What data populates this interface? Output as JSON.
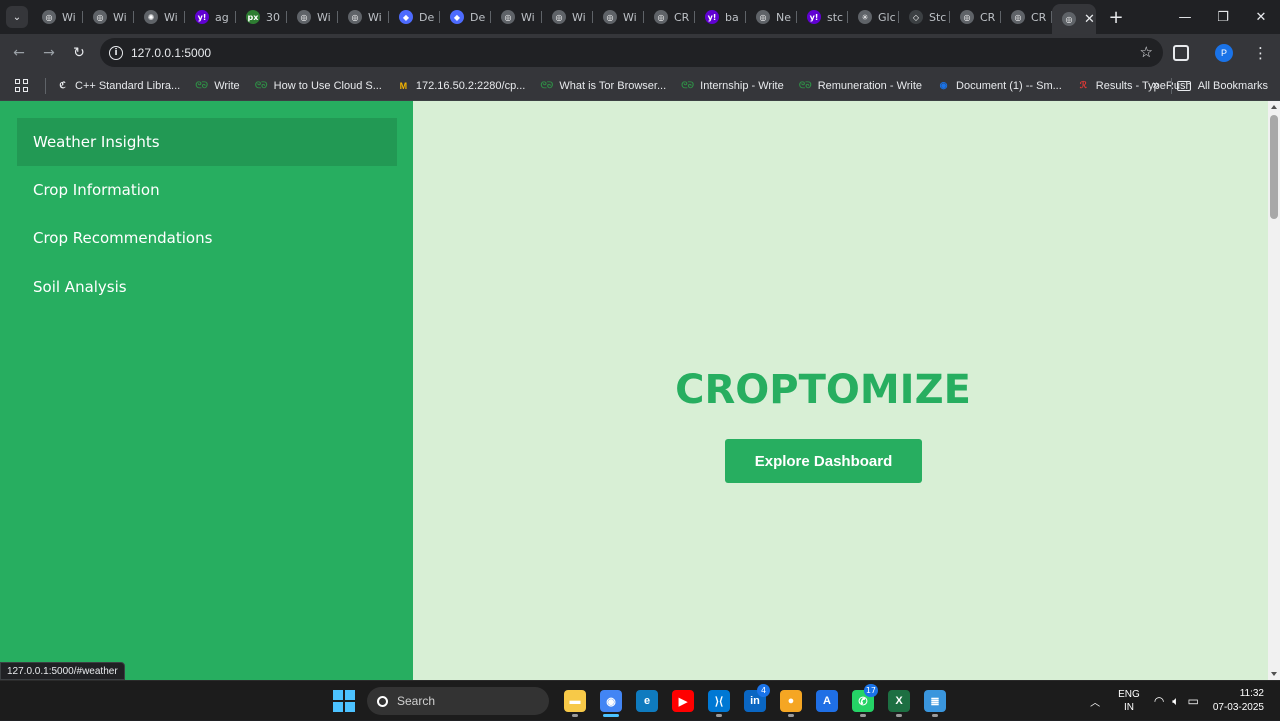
{
  "browser": {
    "tabs": [
      {
        "label": "Wi",
        "icon": "globe-icon"
      },
      {
        "label": "Wi",
        "icon": "globe-icon"
      },
      {
        "label": "Wi",
        "icon": "openai-icon"
      },
      {
        "label": "ag",
        "icon": "yahoo-icon"
      },
      {
        "label": "30",
        "icon": "px-icon"
      },
      {
        "label": "Wi",
        "icon": "globe-icon"
      },
      {
        "label": "Wi",
        "icon": "globe-icon"
      },
      {
        "label": "De",
        "icon": "deepseek-icon"
      },
      {
        "label": "De",
        "icon": "deepseek-icon"
      },
      {
        "label": "Wi",
        "icon": "globe-icon"
      },
      {
        "label": "Wi",
        "icon": "globe-icon"
      },
      {
        "label": "Wi",
        "icon": "globe-icon"
      },
      {
        "label": "CR",
        "icon": "globe-icon"
      },
      {
        "label": "ba",
        "icon": "yahoo-icon"
      },
      {
        "label": "Ne",
        "icon": "globe-icon"
      },
      {
        "label": "stc",
        "icon": "yahoo-icon"
      },
      {
        "label": "Glc",
        "icon": "gemini-icon"
      },
      {
        "label": "Stc",
        "icon": "drop-icon"
      },
      {
        "label": "CR",
        "icon": "globe-icon"
      },
      {
        "label": "CR",
        "icon": "globe-icon"
      }
    ],
    "active_tab_close": "✕",
    "new_tab": "+",
    "window_controls": {
      "minimize": "—",
      "restore": "❐",
      "close": "✕"
    },
    "url": "127.0.0.1:5000",
    "profile_initial": "P",
    "bookmarks": [
      {
        "label": "C++ Standard Libra...",
        "icon": "cpp-icon",
        "color": "#e8eaed"
      },
      {
        "label": "Write",
        "icon": "gfg-icon",
        "color": "#2f8d46"
      },
      {
        "label": "How to Use Cloud S...",
        "icon": "gfg-icon",
        "color": "#2f8d46"
      },
      {
        "label": "172.16.50.2:2280/cp...",
        "icon": "gmail-icon",
        "color": "#f4b400"
      },
      {
        "label": "What is Tor Browser...",
        "icon": "gfg-icon",
        "color": "#2f8d46"
      },
      {
        "label": "Internship - Write",
        "icon": "gfg-icon",
        "color": "#2f8d46"
      },
      {
        "label": "Remuneration - Write",
        "icon": "gfg-icon",
        "color": "#2f8d46"
      },
      {
        "label": "Document (1) -- Sm...",
        "icon": "smallpdf-icon",
        "color": "#1a73e8"
      },
      {
        "label": "Results - TypeRush",
        "icon": "typerush-icon",
        "color": "#e53935"
      }
    ],
    "bookmarks_more": "»",
    "all_bookmarks": "All Bookmarks",
    "status_url": "127.0.0.1:5000/#weather"
  },
  "page": {
    "sidebar": {
      "items": [
        {
          "label": "Weather Insights",
          "active": true
        },
        {
          "label": "Crop Information",
          "active": false
        },
        {
          "label": "Crop Recommendations",
          "active": false
        },
        {
          "label": "Soil Analysis",
          "active": false
        }
      ]
    },
    "main": {
      "brand": "CROPTOMIZE",
      "cta_label": "Explore Dashboard"
    },
    "colors": {
      "primary": "#27ae60",
      "sidebar_active": "#229954",
      "main_bg": "#d8efd5"
    }
  },
  "taskbar": {
    "search_placeholder": "Search",
    "apps": [
      {
        "name": "file-explorer",
        "badge": ""
      },
      {
        "name": "chrome",
        "badge": ""
      },
      {
        "name": "edge",
        "badge": ""
      },
      {
        "name": "youtube",
        "badge": ""
      },
      {
        "name": "vscode",
        "badge": ""
      },
      {
        "name": "linkedin",
        "badge": "4"
      },
      {
        "name": "medal",
        "badge": ""
      },
      {
        "name": "app-store",
        "badge": ""
      },
      {
        "name": "whatsapp",
        "badge": "17"
      },
      {
        "name": "excel",
        "badge": ""
      },
      {
        "name": "notepad",
        "badge": ""
      }
    ],
    "language": {
      "line1": "ENG",
      "line2": "IN"
    },
    "time": "11:32",
    "date": "07-03-2025"
  }
}
